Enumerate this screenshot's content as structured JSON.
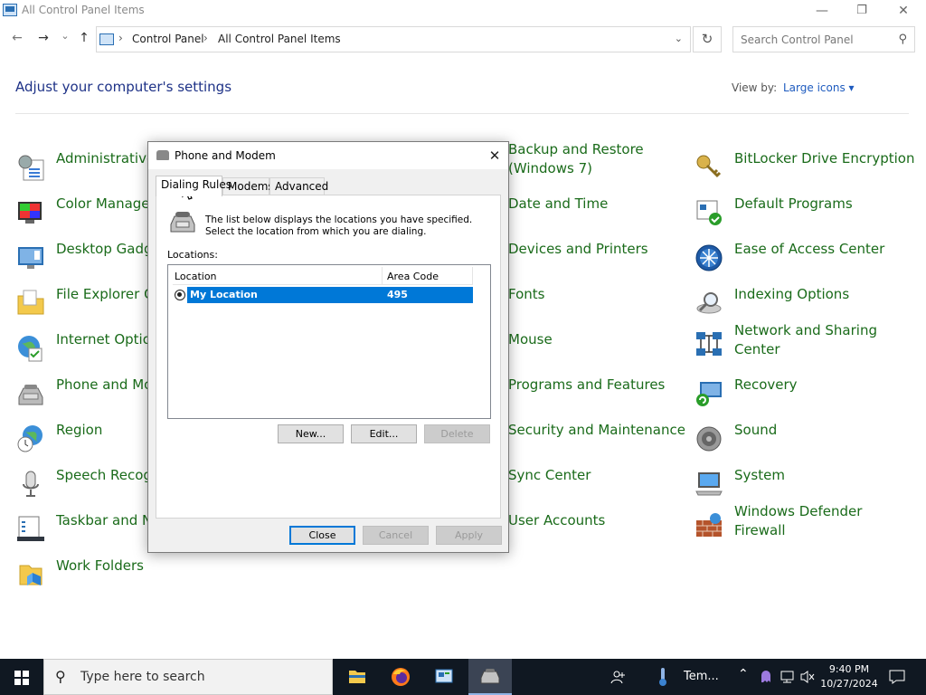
{
  "window": {
    "title": "All Control Panel Items",
    "controls": {
      "minimize": "—",
      "maximize": "❐",
      "close": "✕"
    }
  },
  "nav": {
    "back": "←",
    "forward": "→",
    "recent": "⌄",
    "up": "↑",
    "breadcrumb": [
      "Control Panel",
      "All Control Panel Items"
    ],
    "sep": "›",
    "refresh": "↻",
    "search_placeholder": "Search Control Panel"
  },
  "header": {
    "title": "Adjust your computer's settings",
    "view_by_label": "View by:",
    "view_by_value": "Large icons ▾"
  },
  "items": {
    "col1": [
      "Administrative Tools",
      "Color Management",
      "Desktop Gadgets",
      "File Explorer Options",
      "Internet Options",
      "Phone and Modem",
      "Region",
      "Speech Recognition",
      "Taskbar and Navigation",
      "Work Folders"
    ],
    "col3": [
      "Backup and Restore (Windows 7)",
      "Date and Time",
      "Devices and Printers",
      "Fonts",
      "Mouse",
      "Programs and Features",
      "Security and Maintenance",
      "Sync Center",
      "User Accounts"
    ],
    "col4": [
      "BitLocker Drive Encryption",
      "Default Programs",
      "Ease of Access Center",
      "Indexing Options",
      "Network and Sharing Center",
      "Recovery",
      "Sound",
      "System",
      "Windows Defender Firewall"
    ]
  },
  "dialog": {
    "title": "Phone and Modem",
    "close": "✕",
    "tabs": [
      "Dialing Rules",
      "Modems",
      "Advanced"
    ],
    "description": "The list below displays the locations you have specified. Select the location from which you are dialing.",
    "locations_label": "Locations:",
    "columns": [
      "Location",
      "Area Code"
    ],
    "rows": [
      {
        "location": "My Location",
        "area_code": "495"
      }
    ],
    "buttons": {
      "new": "New...",
      "edit": "Edit...",
      "delete": "Delete",
      "close": "Close",
      "cancel": "Cancel",
      "apply": "Apply"
    }
  },
  "taskbar": {
    "search_placeholder": "Type here to search",
    "weather_text": "Tem...",
    "time": "9:40 PM",
    "date": "10/27/2024"
  }
}
